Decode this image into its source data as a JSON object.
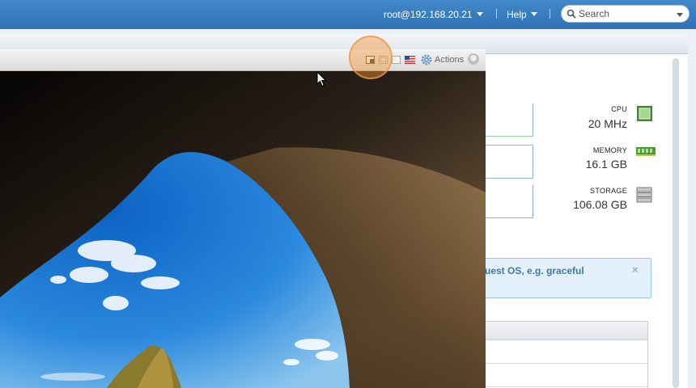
{
  "header": {
    "user": "root@192.168.20.21",
    "help": "Help",
    "search_placeholder": "Search"
  },
  "console": {
    "actions_label": "Actions",
    "close_glyph": "⊗",
    "toolbar_icons": [
      "restore-window-icon",
      "fit-window-icon",
      "fullscreen-icon",
      "keyboard-layout-flag-icon",
      "gear-icon"
    ]
  },
  "stats": [
    {
      "label": "CPU",
      "value": "20 MHz",
      "icon": "cpu-icon"
    },
    {
      "label": "MEMORY",
      "value": "16.1 GB",
      "icon": "memory-icon"
    },
    {
      "label": "STORAGE",
      "value": "106.08 GB",
      "icon": "storage-icon"
    }
  ],
  "alert": {
    "text": "uest OS, e.g. graceful",
    "close": "×"
  },
  "colors": {
    "header": "#2f72b5",
    "accent_highlight": "#f0963c",
    "alert_text": "#3d79a8"
  }
}
